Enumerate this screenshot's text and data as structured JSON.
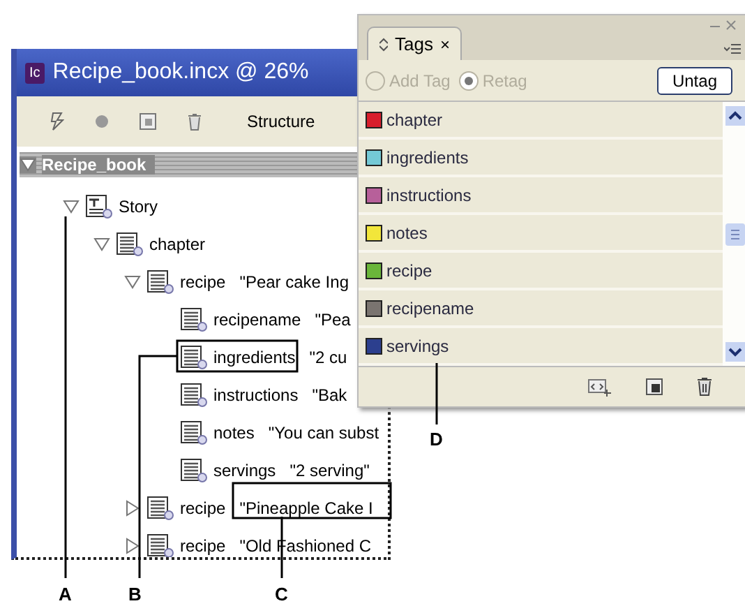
{
  "document_window": {
    "app_icon": "Ic",
    "title": "Recipe_book.incx @ 26%",
    "toolbar_label": "Structure",
    "root": {
      "label": "Recipe_book",
      "expanded": true
    },
    "tree": [
      {
        "kind": "story",
        "tag": "Story",
        "expanded": true,
        "children": [
          {
            "kind": "element",
            "tag": "chapter",
            "expanded": true,
            "children": [
              {
                "kind": "element",
                "tag": "recipe",
                "value": "\"Pear cake Ing",
                "expanded": true,
                "children": [
                  {
                    "kind": "element",
                    "tag": "recipename",
                    "value": "\"Pea"
                  },
                  {
                    "kind": "element",
                    "tag": "ingredients",
                    "value": "\"2 cu"
                  },
                  {
                    "kind": "element",
                    "tag": "instructions",
                    "value": "\"Bak"
                  },
                  {
                    "kind": "element",
                    "tag": "notes",
                    "value": "\"You can subst"
                  },
                  {
                    "kind": "element",
                    "tag": "servings",
                    "value": "\"2 serving\""
                  }
                ]
              },
              {
                "kind": "element",
                "tag": "recipe",
                "value": "\"Pineapple Cake I",
                "expanded": false
              },
              {
                "kind": "element",
                "tag": "recipe",
                "value": "\"Old Fashioned C",
                "expanded": false
              }
            ]
          }
        ]
      }
    ]
  },
  "tags_panel": {
    "tab": "Tags",
    "tab_close": "×",
    "add_tag": {
      "label": "Add Tag",
      "selected": false,
      "disabled": true
    },
    "retag": {
      "label": "Retag",
      "selected": true,
      "disabled": true
    },
    "untag": "Untag",
    "tags": [
      {
        "name": "chapter",
        "color": "#d81e2c"
      },
      {
        "name": "ingredients",
        "color": "#74c9d6"
      },
      {
        "name": "instructions",
        "color": "#b7609a"
      },
      {
        "name": "notes",
        "color": "#f2e63a"
      },
      {
        "name": "recipe",
        "color": "#6ab63a"
      },
      {
        "name": "recipename",
        "color": "#7a7470"
      },
      {
        "name": "servings",
        "color": "#2c3f8e"
      }
    ]
  },
  "callouts": [
    "A",
    "B",
    "C",
    "D"
  ]
}
